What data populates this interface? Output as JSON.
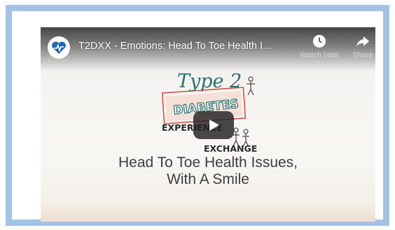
{
  "video": {
    "title": "T2DXX - Emotions: Head To Toe Health I...",
    "actions": {
      "watch_later": "Watch later",
      "share": "Share"
    },
    "thumbnail": {
      "logo": {
        "line1": "Type 2",
        "line2": "DIABETES",
        "line3": "EXPERIENCE",
        "line4": "EXCHANGE"
      },
      "headline_line1": "Head To Toe Health Issues,",
      "headline_line2": "With A Smile"
    }
  },
  "icons": {
    "avatar": "heart-pulse-icon",
    "watch_later": "clock-icon",
    "share": "share-arrow-icon",
    "play": "play-icon"
  },
  "colors": {
    "frame_border": "#a3c3e6",
    "avatar_blue": "#1f6bb5",
    "logo_teal": "#2a6f73",
    "logo_red": "#d2453a"
  }
}
